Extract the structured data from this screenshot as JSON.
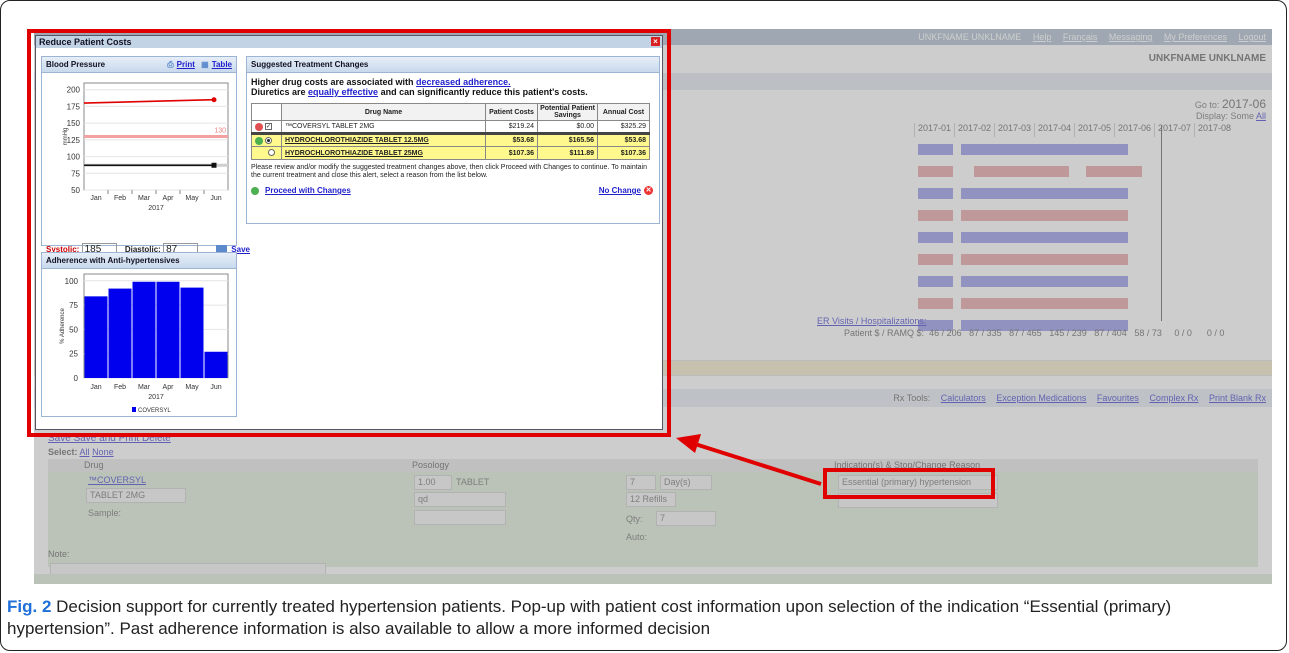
{
  "background": {
    "topbar_links": [
      "UNKFNAME UNKLNAME",
      "Help",
      "Français",
      "Messaging",
      "My Preferences",
      "Logout"
    ],
    "username": "UNKFNAME UNKLNAME",
    "goto_label": "Go to:",
    "goto_value": "2017-06",
    "display_label": "Display: Some",
    "display_all": "All",
    "months": [
      "2017-01",
      "2017-02",
      "2017-03",
      "2017-04",
      "2017-05",
      "2017-06",
      "2017-07",
      "2017-08"
    ],
    "er_visits": "ER Visits / Hospitalizations:",
    "patient_summary_label": "Patient $ / RAMQ $:",
    "patient_summary_values": [
      "46 / 206",
      "87 / 335",
      "87 / 465",
      "145 / 239",
      "87 / 404",
      "58 / 73",
      "0 / 0",
      "0 / 0"
    ],
    "rx_tools_label": "Rx Tools:",
    "rx_tools": [
      "Calculators",
      "Exception Medications",
      "Favourites",
      "Complex Rx",
      "Print Blank Rx"
    ],
    "save_links": "Save   Save and Print   Delete",
    "select_label": "Select:",
    "select_all": "All",
    "select_none": "None",
    "col_drug": "Drug",
    "col_posology": "Posology",
    "col_indication": "Indication(s) & Stop/Change Reason",
    "rx": {
      "drug_link": "™COVERSYL",
      "form": "TABLET 2MG",
      "sample": "Sample:",
      "dose": "1.00",
      "unit": "TABLET",
      "freq": "qd",
      "duration": "7",
      "duration_unit": "Day(s)",
      "refills": "12 Refills",
      "qty_label": "Qty:",
      "qty": "7",
      "auto_label": "Auto:",
      "indication": "Essential (primary) hypertension"
    },
    "note_label": "Note:"
  },
  "popup": {
    "title": "Reduce Patient Costs",
    "bp": {
      "title": "Blood Pressure",
      "print": "Print",
      "table": "Table",
      "systolic_label": "Systolic:",
      "systolic": "185",
      "diastolic_label": "Diastolic:",
      "diastolic": "87",
      "save": "Save"
    },
    "adherence": {
      "title": "Adherence with Anti-hypertensives"
    },
    "suggested": {
      "title": "Suggested Treatment Changes",
      "line1_a": "Higher drug costs are associated with ",
      "line1_link": "decreased adherence.",
      "line2_a": "Diuretics are ",
      "line2_link": "equally effective",
      "line2_b": " and can significantly reduce this patient's costs.",
      "headers": [
        "Drug Name",
        "Patient Costs",
        "Potential Patient Savings",
        "Annual Cost"
      ],
      "rows": [
        {
          "name": "™COVERSYL TABLET 2MG",
          "patient_cost": "$219.24",
          "savings": "$0.00",
          "annual": "$325.29",
          "kind": "current"
        },
        {
          "name": "HYDROCHLOROTHIAZIDE TABLET 12.5MG",
          "patient_cost": "$53.68",
          "savings": "$165.56",
          "annual": "$53.68",
          "kind": "alt-selected"
        },
        {
          "name": "HYDROCHLOROTHIAZIDE TABLET 25MG",
          "patient_cost": "$107.36",
          "savings": "$111.89",
          "annual": "$107.36",
          "kind": "alt"
        }
      ],
      "review": "Please review and/or modify the suggested treatment changes above, then click Proceed with Changes to continue. To maintain the current treatment and close this alert, select a reason from the list below.",
      "proceed": "Proceed with Changes",
      "no_change": "No Change"
    }
  },
  "caption": {
    "label": "Fig. 2",
    "text": " Decision support for currently treated hypertension patients. Pop-up with patient cost information upon selection of the indication “Essential (primary) hypertension”. Past adherence information is also available to allow a more informed decision"
  },
  "colors": {
    "highlight": "#e00000",
    "accent_blue": "#1e6fd9",
    "bar_blue": "#0000ee",
    "systolic_red": "#e00000",
    "alt_row": "#fff88c"
  },
  "chart_data": [
    {
      "type": "line",
      "x": [
        "Jan",
        "Feb",
        "Mar",
        "Apr",
        "May",
        "Jun"
      ],
      "xlabel": "2017",
      "ylabel": "mmHg",
      "ylim": [
        50,
        210
      ],
      "yticks": [
        50,
        75,
        100,
        125,
        150,
        175,
        200
      ],
      "threshold_label": "130",
      "threshold": 130,
      "series": [
        {
          "name": "Systolic",
          "color": "#e00000",
          "x": [
            0.0,
            5.0
          ],
          "values": [
            180,
            185
          ]
        },
        {
          "name": "Diastolic",
          "color": "#111111",
          "x": [
            0.0,
            5.0
          ],
          "values": [
            87,
            87
          ]
        }
      ]
    },
    {
      "type": "bar",
      "categories": [
        "Jan",
        "Feb",
        "Mar",
        "Apr",
        "May",
        "Jun"
      ],
      "values": [
        84,
        92,
        99,
        99,
        93,
        27
      ],
      "xlabel": "2017",
      "ylabel": "% Adherence",
      "ylim": [
        0,
        107
      ],
      "yticks": [
        0,
        25,
        50,
        75,
        100
      ],
      "legend": [
        "COVERSYL"
      ]
    }
  ]
}
